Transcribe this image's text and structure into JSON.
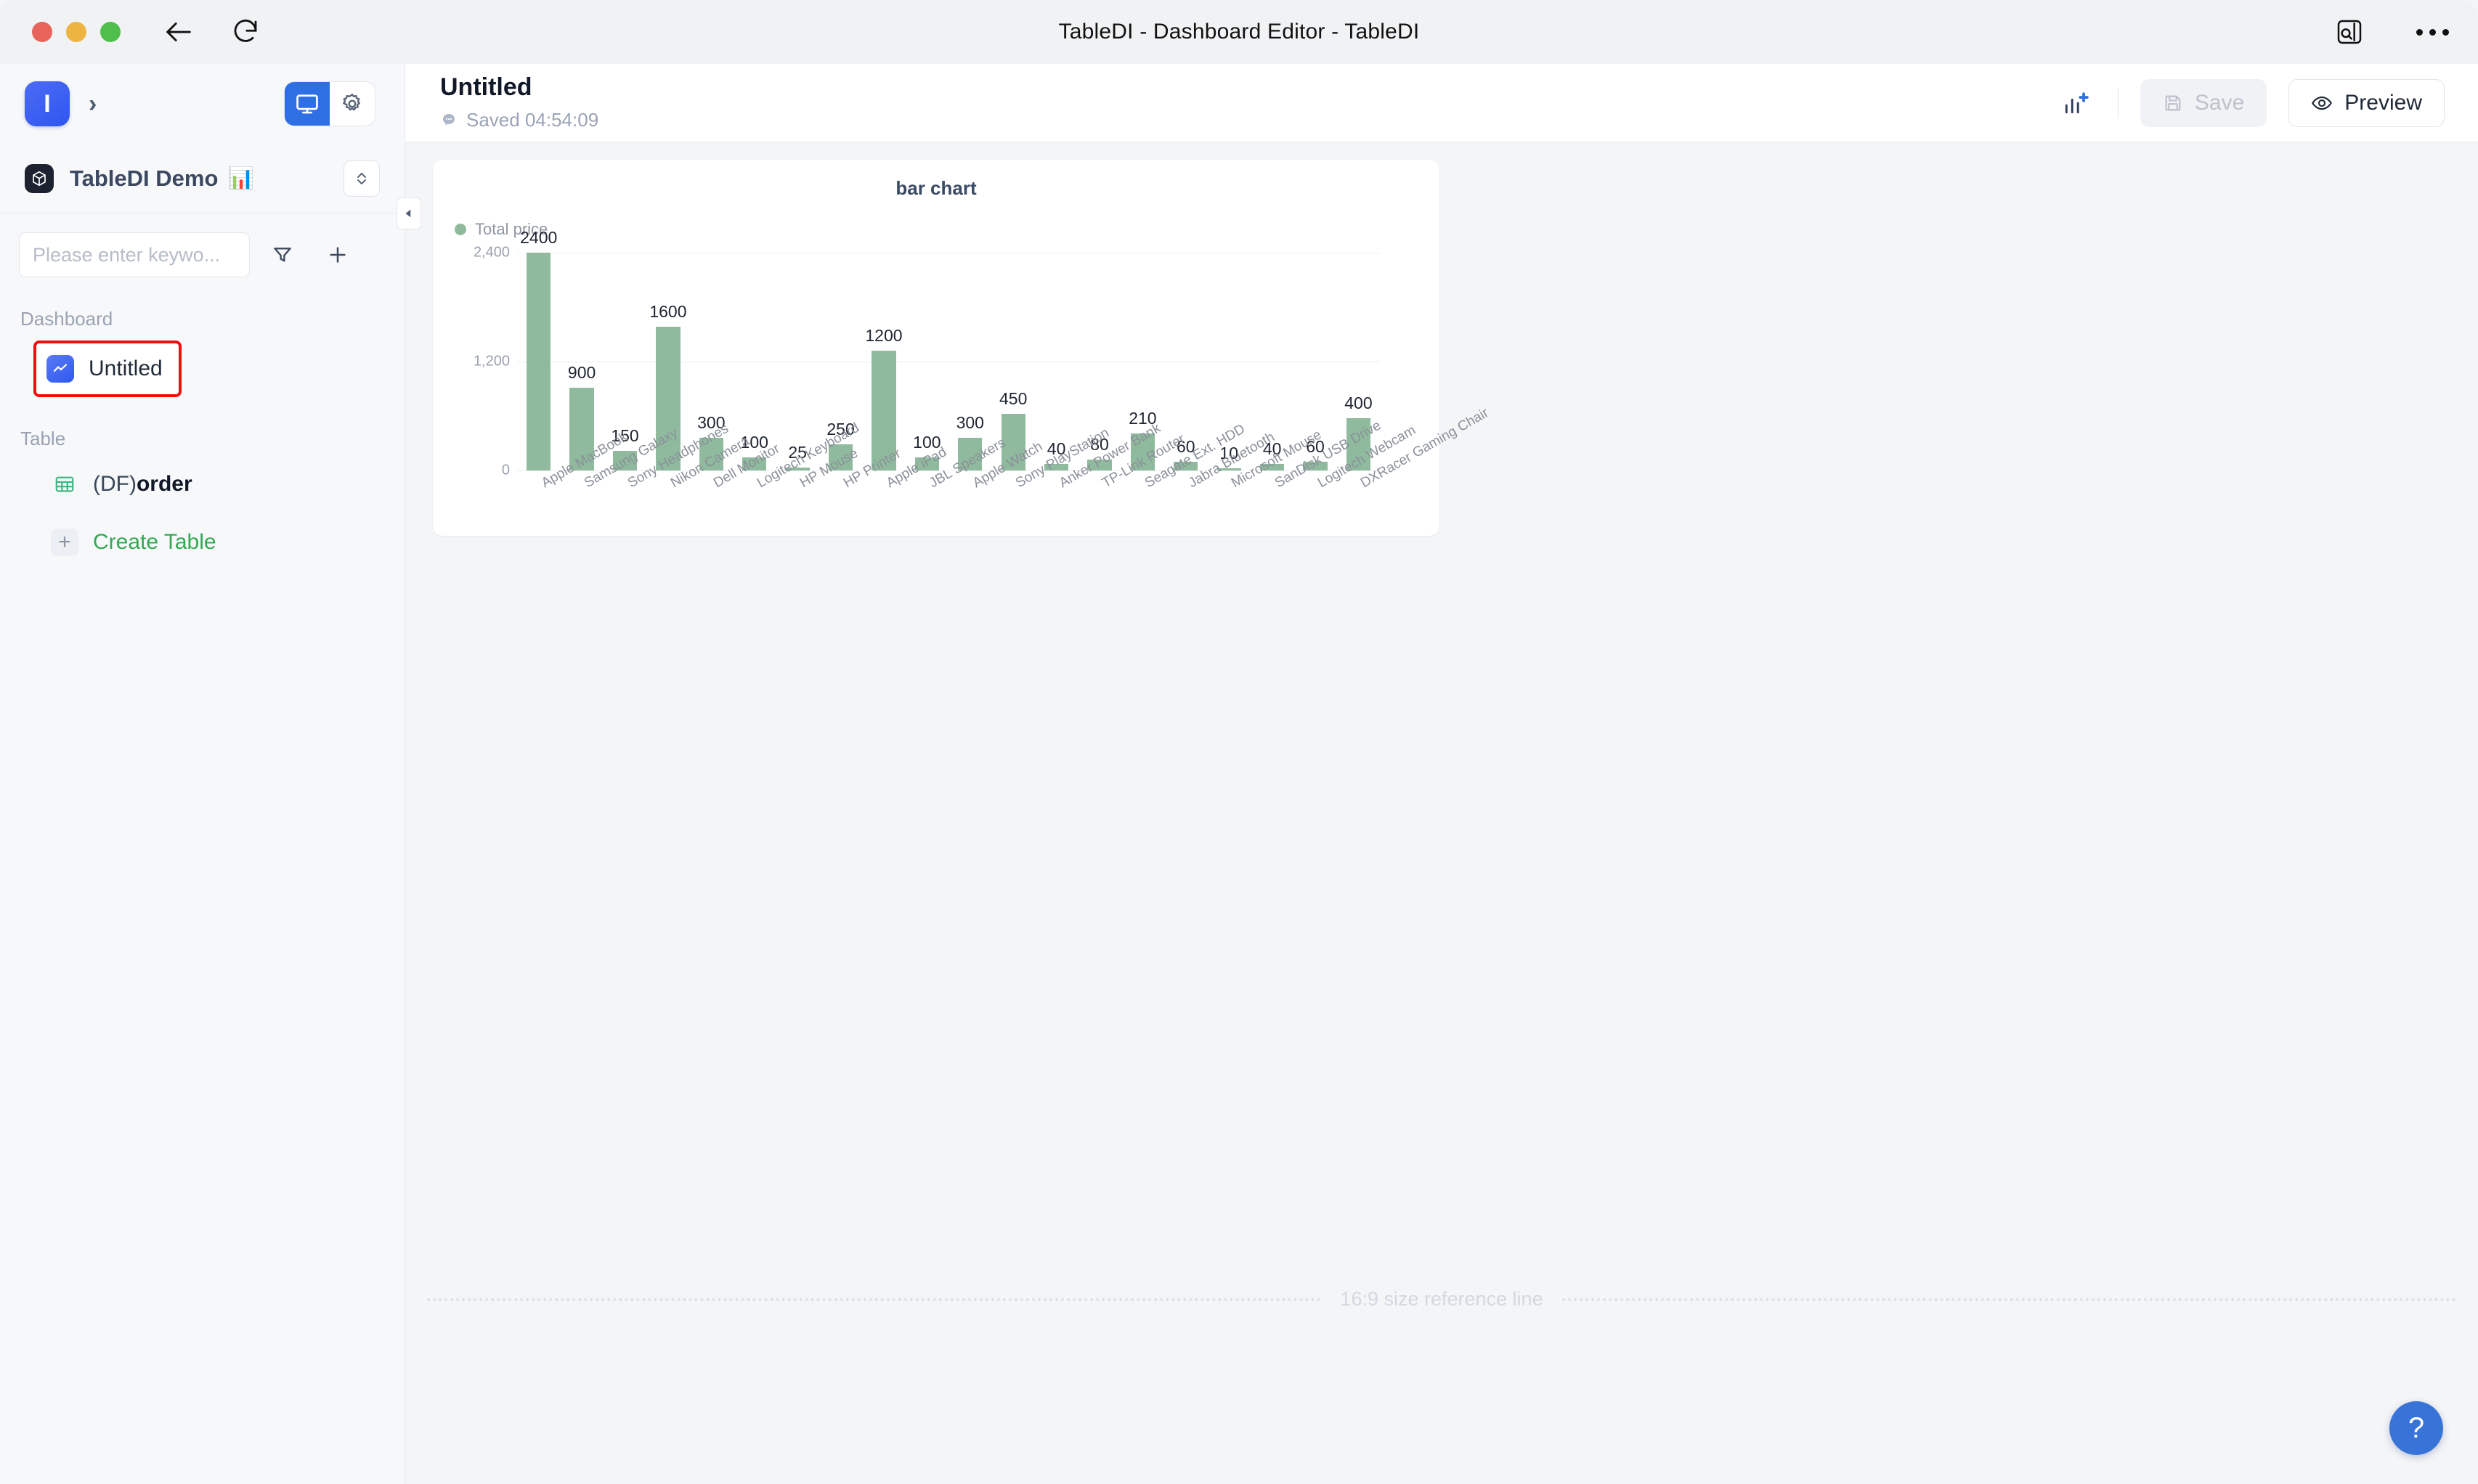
{
  "window": {
    "title": "TableDI - Dashboard Editor - TableDI",
    "traffic_lights": [
      "close-red",
      "minimize-yellow",
      "maximize-green"
    ],
    "back_icon": "back-arrow-icon",
    "reload_icon": "reload-icon",
    "sidebar_toggle_icon": "search-panel-icon",
    "more_icon": "more-options-icon"
  },
  "sidebar": {
    "workspace_avatar": "I",
    "workspace_chevron": "›",
    "view_toggle": {
      "dashboard_icon": "monitor-icon",
      "settings_icon": "gear-icon"
    },
    "project": {
      "icon": "cube-icon",
      "name": "TableDI Demo",
      "emoji": "📊",
      "switch_icon": "expand-collapse-icon"
    },
    "search": {
      "placeholder": "Please enter keywo...",
      "value": "",
      "search_icon": "search-icon",
      "filter_icon": "filter-icon",
      "add_icon": "plus-icon"
    },
    "sections": [
      {
        "label": "Dashboard",
        "items": [
          {
            "label": "Untitled",
            "icon": "chart-line-icon",
            "selected": true
          }
        ]
      },
      {
        "label": "Table",
        "items": [
          {
            "label_prefix": "(DF)",
            "label_bold": "order",
            "icon": "table-grid-icon",
            "selected": false
          },
          {
            "label": "Create Table",
            "icon": "plus-icon",
            "selected": false
          }
        ]
      }
    ]
  },
  "collapse_handle": {
    "icon": "collapse-left-icon"
  },
  "main": {
    "header": {
      "title": "Untitled",
      "saved_icon": "cloud-saved-icon",
      "saved_text": "Saved 04:54:09",
      "add_chart_icon": "add-chart-icon",
      "save_label": "Save",
      "save_icon": "floppy-disk-icon",
      "preview_label": "Preview",
      "preview_icon": "eye-icon"
    },
    "reference_line_text": "16:9 size reference line",
    "help_button": {
      "icon": "question-mark-icon",
      "label": "?"
    }
  },
  "chart_data": {
    "type": "bar",
    "title": "bar chart",
    "xlabel": "",
    "ylabel": "",
    "grid": true,
    "legend_position": "top-left",
    "series": [
      {
        "name": "Total price",
        "color": "#8fba9d",
        "values": [
          2400,
          900,
          150,
          1600,
          300,
          100,
          25,
          250,
          1200,
          100,
          300,
          450,
          40,
          80,
          210,
          60,
          10,
          40,
          60,
          400
        ]
      }
    ],
    "categories": [
      "Apple MacBook",
      "Samsung Galaxy",
      "Sony Headphones",
      "Nikon Camera",
      "Dell Monitor",
      "Logitech Keyboard",
      "HP Mouse",
      "HP Printer",
      "Apple iPad",
      "JBL Speakers",
      "Apple Watch",
      "Sony PlayStation",
      "Anker Power Bank",
      "TP-Link Router",
      "Seagate Ext. HDD",
      "Jabra Bluetooth",
      "Microsoft Mouse",
      "SanDisk USB Drive",
      "Logitech Webcam",
      "DXRacer Gaming Chair"
    ],
    "yticks": [
      "0",
      "1,200",
      "2,400"
    ],
    "ytick_values": [
      0,
      1200,
      2400
    ],
    "ylim": [
      0,
      2400
    ],
    "bar_pixel_heights": [
      100,
      38,
      9,
      66,
      15,
      6,
      1.5,
      12,
      55,
      6,
      15,
      26,
      3,
      5,
      17,
      4,
      1,
      3,
      4,
      24
    ]
  }
}
